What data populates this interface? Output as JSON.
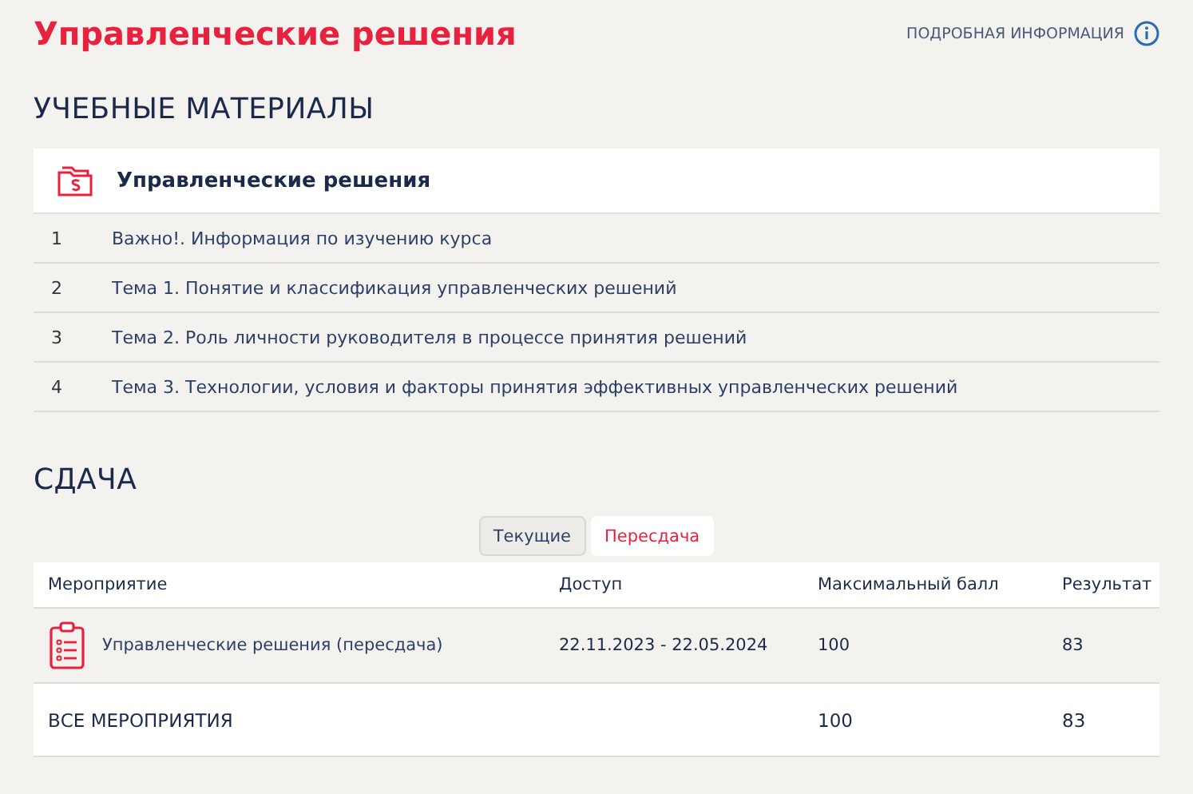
{
  "page_title": "Управленческие решения",
  "info_link": "ПОДРОБНАЯ ИНФОРМАЦИЯ",
  "materials": {
    "heading": "УЧЕБНЫЕ МАТЕРИАЛЫ",
    "course": "Управленческие решения",
    "items": [
      {
        "number": "1",
        "title": "Важно!. Информация по изучению курса"
      },
      {
        "number": "2",
        "title": "Тема 1. Понятие и классификация управленческих решений"
      },
      {
        "number": "3",
        "title": "Тема 2. Роль личности руководителя в процессе принятия решений"
      },
      {
        "number": "4",
        "title": "Тема 3. Технологии, условия и факторы принятия эффективных управленческих решений"
      }
    ]
  },
  "submission": {
    "heading": "СДАЧА",
    "tabs": [
      {
        "label": "Текущие",
        "selected": false
      },
      {
        "label": "Пересдача",
        "selected": true
      }
    ],
    "table": {
      "columns": [
        "Мероприятие",
        "Доступ",
        "Максимальный балл",
        "Результат"
      ],
      "rows": [
        {
          "event": "Управленческие решения (пересдача)",
          "access": "22.11.2023 - 22.05.2024",
          "max_score": "100",
          "result": "83"
        }
      ],
      "total": {
        "label": "ВСЕ МЕРОПРИЯТИЯ",
        "max_score": "100",
        "result": "83"
      }
    }
  }
}
